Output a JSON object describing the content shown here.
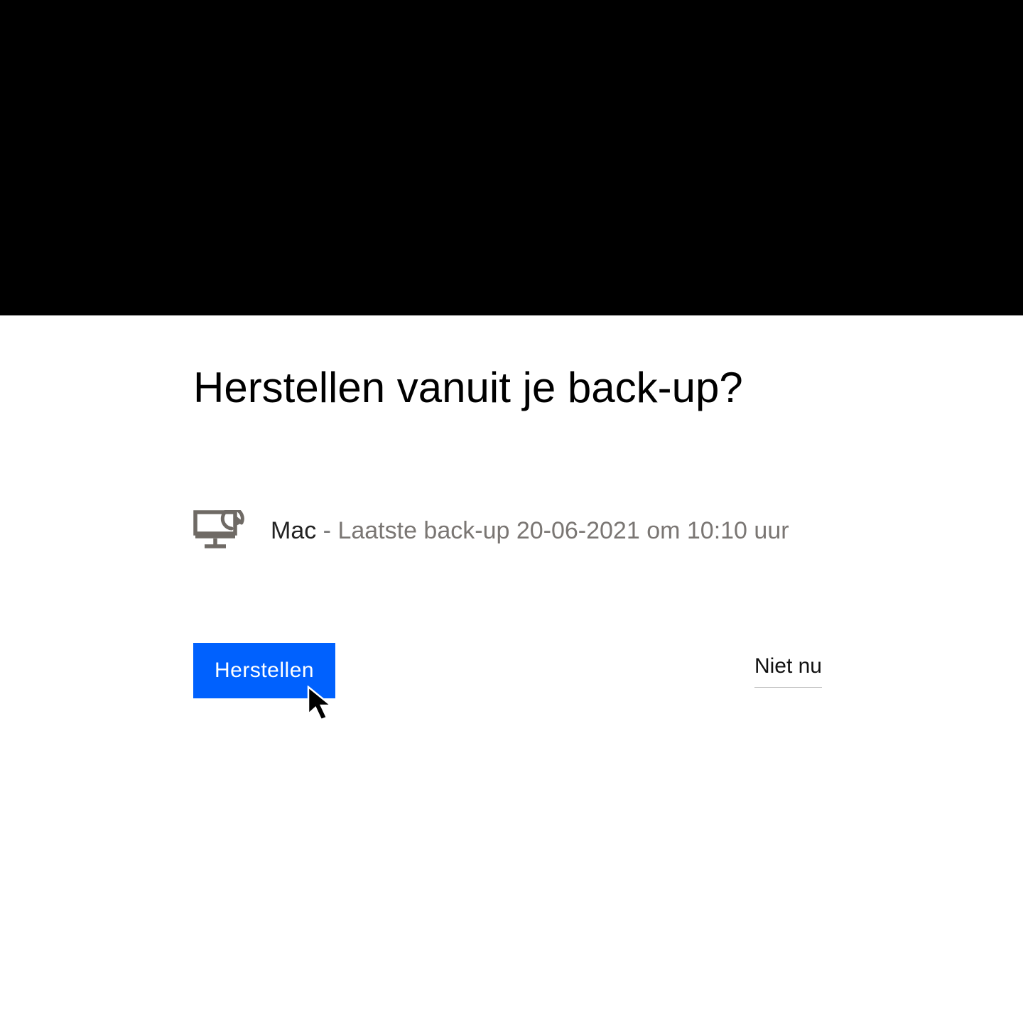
{
  "dialog": {
    "title": "Herstellen vanuit je back-up?",
    "device": {
      "name": "Mac",
      "separator": " - ",
      "detail": "Laatste back-up 20-06-2021 om 10:10 uur"
    },
    "primary_label": "Herstellen",
    "secondary_label": "Niet nu"
  }
}
